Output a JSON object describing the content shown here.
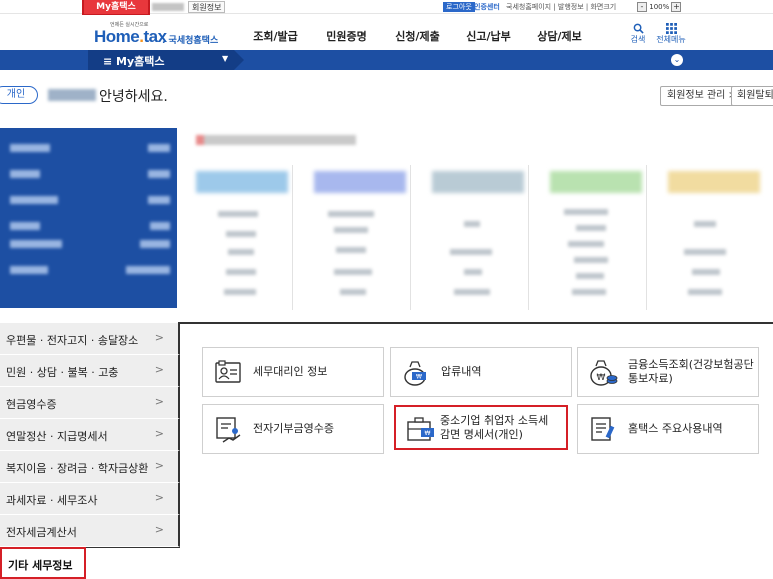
{
  "topbar": {
    "my_hometax_tab": "My홈택스",
    "member_info": "회원정보",
    "logout": "로그아웃",
    "cert_select": "인증센터",
    "util_links": "국세청홈페이지 | 발행정보 | 화면크기",
    "zoom_minus": "-",
    "zoom_value": "100%",
    "zoom_plus": "+"
  },
  "header": {
    "logo_small": "언제든 실시간으로",
    "logo_text_a": "Home",
    "logo_text_b": "tax",
    "logo_sub": ". 국세청홈택스",
    "gnb": [
      "조회/발급",
      "민원증명",
      "신청/제출",
      "신고/납부",
      "상담/제보"
    ],
    "search_label": "검색",
    "all_menu_label": "전체메뉴"
  },
  "navbar": {
    "title": "≡  My홈택스",
    "caret": "▼",
    "expand_icon": "⌄"
  },
  "greeting": {
    "badge": "개인",
    "text": "안녕하세요.",
    "member_manage": "회원정보 관리 >",
    "withdraw": "회원탈퇴"
  },
  "side_menu": {
    "items": [
      "우편물 · 전자고지 · 송달장소",
      "민원 · 상담 · 불복 · 고충",
      "현금영수증",
      "연말정산 · 지급명세서",
      "복지이음 · 장려금 · 학자금상환",
      "과세자료 · 세무조사",
      "전자세금계산서"
    ],
    "active": "기타 세무정보",
    "chevron": ">"
  },
  "cards": [
    {
      "line1": "세무대리인 정보",
      "line2": "",
      "icon": "person-card-icon"
    },
    {
      "line1": "압류내역",
      "line2": "",
      "icon": "money-bag-seizure-icon"
    },
    {
      "line1": "금융소득조회(건강보험공단",
      "line2": "통보자료)",
      "icon": "money-bag-coin-icon"
    },
    {
      "line1": "전자기부금영수증",
      "line2": "",
      "icon": "donation-receipt-icon"
    },
    {
      "line1": "중소기업 취업자 소득세",
      "line2": "감면 명세서(개인)",
      "icon": "briefcase-won-icon"
    },
    {
      "line1": "홈택스 주요사용내역",
      "line2": "",
      "icon": "document-pen-icon"
    }
  ],
  "colors": {
    "brand_blue": "#1d4fa3",
    "highlight_red": "#d51f26",
    "side_bg": "#eeeeee"
  }
}
